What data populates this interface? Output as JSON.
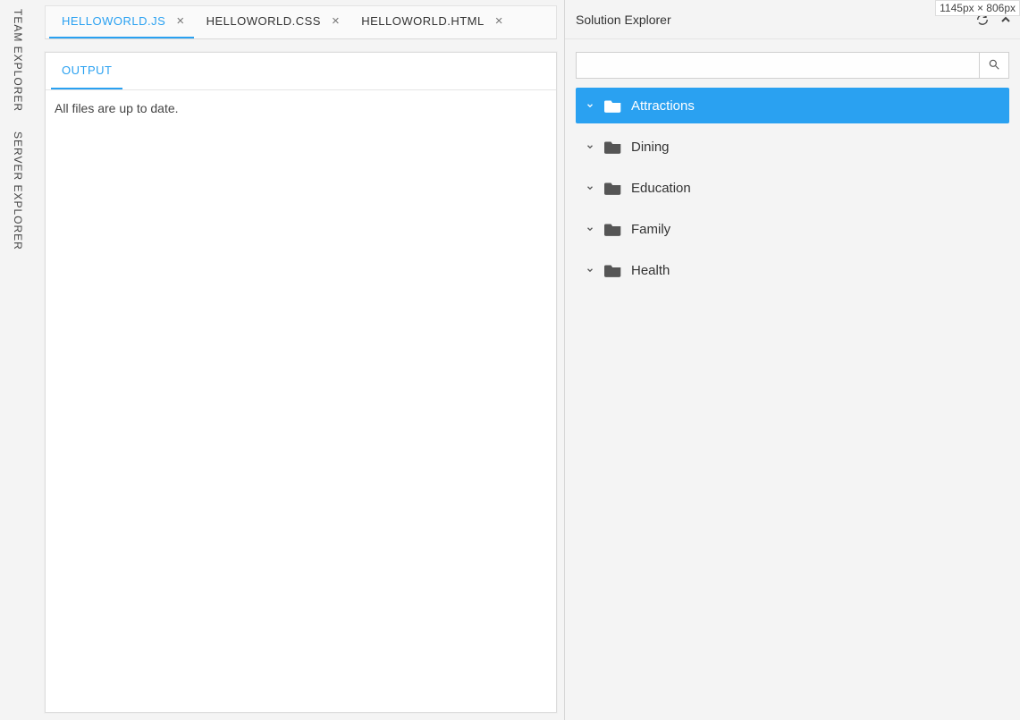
{
  "dimensions_badge": "1145px × 806px",
  "rail": {
    "items": [
      {
        "label": "TEAM EXPLORER"
      },
      {
        "label": "SERVER EXPLORER"
      }
    ]
  },
  "file_tabs": [
    {
      "label": "HELLOWORLD.JS",
      "active": true
    },
    {
      "label": "HELLOWORLD.CSS",
      "active": false
    },
    {
      "label": "HELLOWORLD.HTML",
      "active": false
    }
  ],
  "inner_tabs": [
    {
      "label": "OUTPUT",
      "active": true
    }
  ],
  "output_text": "All files are up to date.",
  "solution_explorer": {
    "title": "Solution Explorer",
    "search_value": "",
    "tree": [
      {
        "label": "Attractions",
        "selected": true
      },
      {
        "label": "Dining",
        "selected": false
      },
      {
        "label": "Education",
        "selected": false
      },
      {
        "label": "Family",
        "selected": false
      },
      {
        "label": "Health",
        "selected": false
      }
    ]
  }
}
